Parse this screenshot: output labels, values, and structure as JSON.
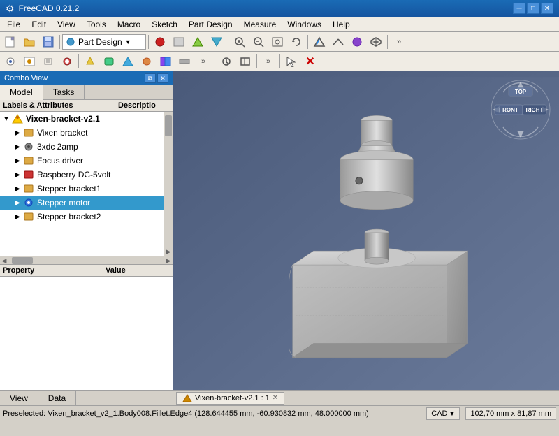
{
  "app": {
    "title": "FreeCAD 0.21.2",
    "icon": "⚙"
  },
  "titlebar": {
    "title": "FreeCAD 0.21.2",
    "minimize": "─",
    "maximize": "□",
    "close": "✕"
  },
  "menubar": {
    "items": [
      "File",
      "Edit",
      "View",
      "Tools",
      "Macro",
      "Sketch",
      "Part Design",
      "Measure",
      "Windows",
      "Help"
    ]
  },
  "toolbar1": {
    "dropdown_label": "Part Design"
  },
  "comboview": {
    "title": "Combo View"
  },
  "tabs": {
    "model": "Model",
    "tasks": "Tasks"
  },
  "tree": {
    "col1": "Labels & Attributes",
    "col2": "Descriptio",
    "items": [
      {
        "id": "root",
        "label": "Vixen-bracket-v2.1",
        "level": 0,
        "expanded": true,
        "icon": "star",
        "bold": true
      },
      {
        "id": "item1",
        "label": "Vixen bracket",
        "level": 1,
        "expanded": false,
        "icon": "box"
      },
      {
        "id": "item2",
        "label": "3xdc 2amp",
        "level": 1,
        "expanded": false,
        "icon": "gear"
      },
      {
        "id": "item3",
        "label": "Focus driver",
        "level": 1,
        "expanded": false,
        "icon": "box"
      },
      {
        "id": "item4",
        "label": "Raspberry DC-5volt",
        "level": 1,
        "expanded": false,
        "icon": "pi"
      },
      {
        "id": "item5",
        "label": "Stepper bracket1",
        "level": 1,
        "expanded": false,
        "icon": "box"
      },
      {
        "id": "item6",
        "label": "Stepper motor",
        "level": 1,
        "expanded": false,
        "icon": "blue",
        "selected": true
      },
      {
        "id": "item7",
        "label": "Stepper bracket2",
        "level": 1,
        "expanded": false,
        "icon": "box"
      }
    ]
  },
  "property": {
    "col1": "Property",
    "col2": "Value"
  },
  "bottom_tabs": {
    "view": "View",
    "data": "Data"
  },
  "viewport_tab": {
    "label": "Vixen-bracket-v2.1 : 1"
  },
  "statusbar": {
    "preselected": "Preselected: Vixen_bracket_v2_1.Body008.Fillet.Edge4 (128.644455 mm, -60.930832 mm, 48.000000 mm)",
    "cad_label": "CAD",
    "dimensions": "102,70 mm x 81,87 mm"
  },
  "navcube": {
    "top": "TOP",
    "front": "FRONT",
    "right": "RIGHT"
  }
}
